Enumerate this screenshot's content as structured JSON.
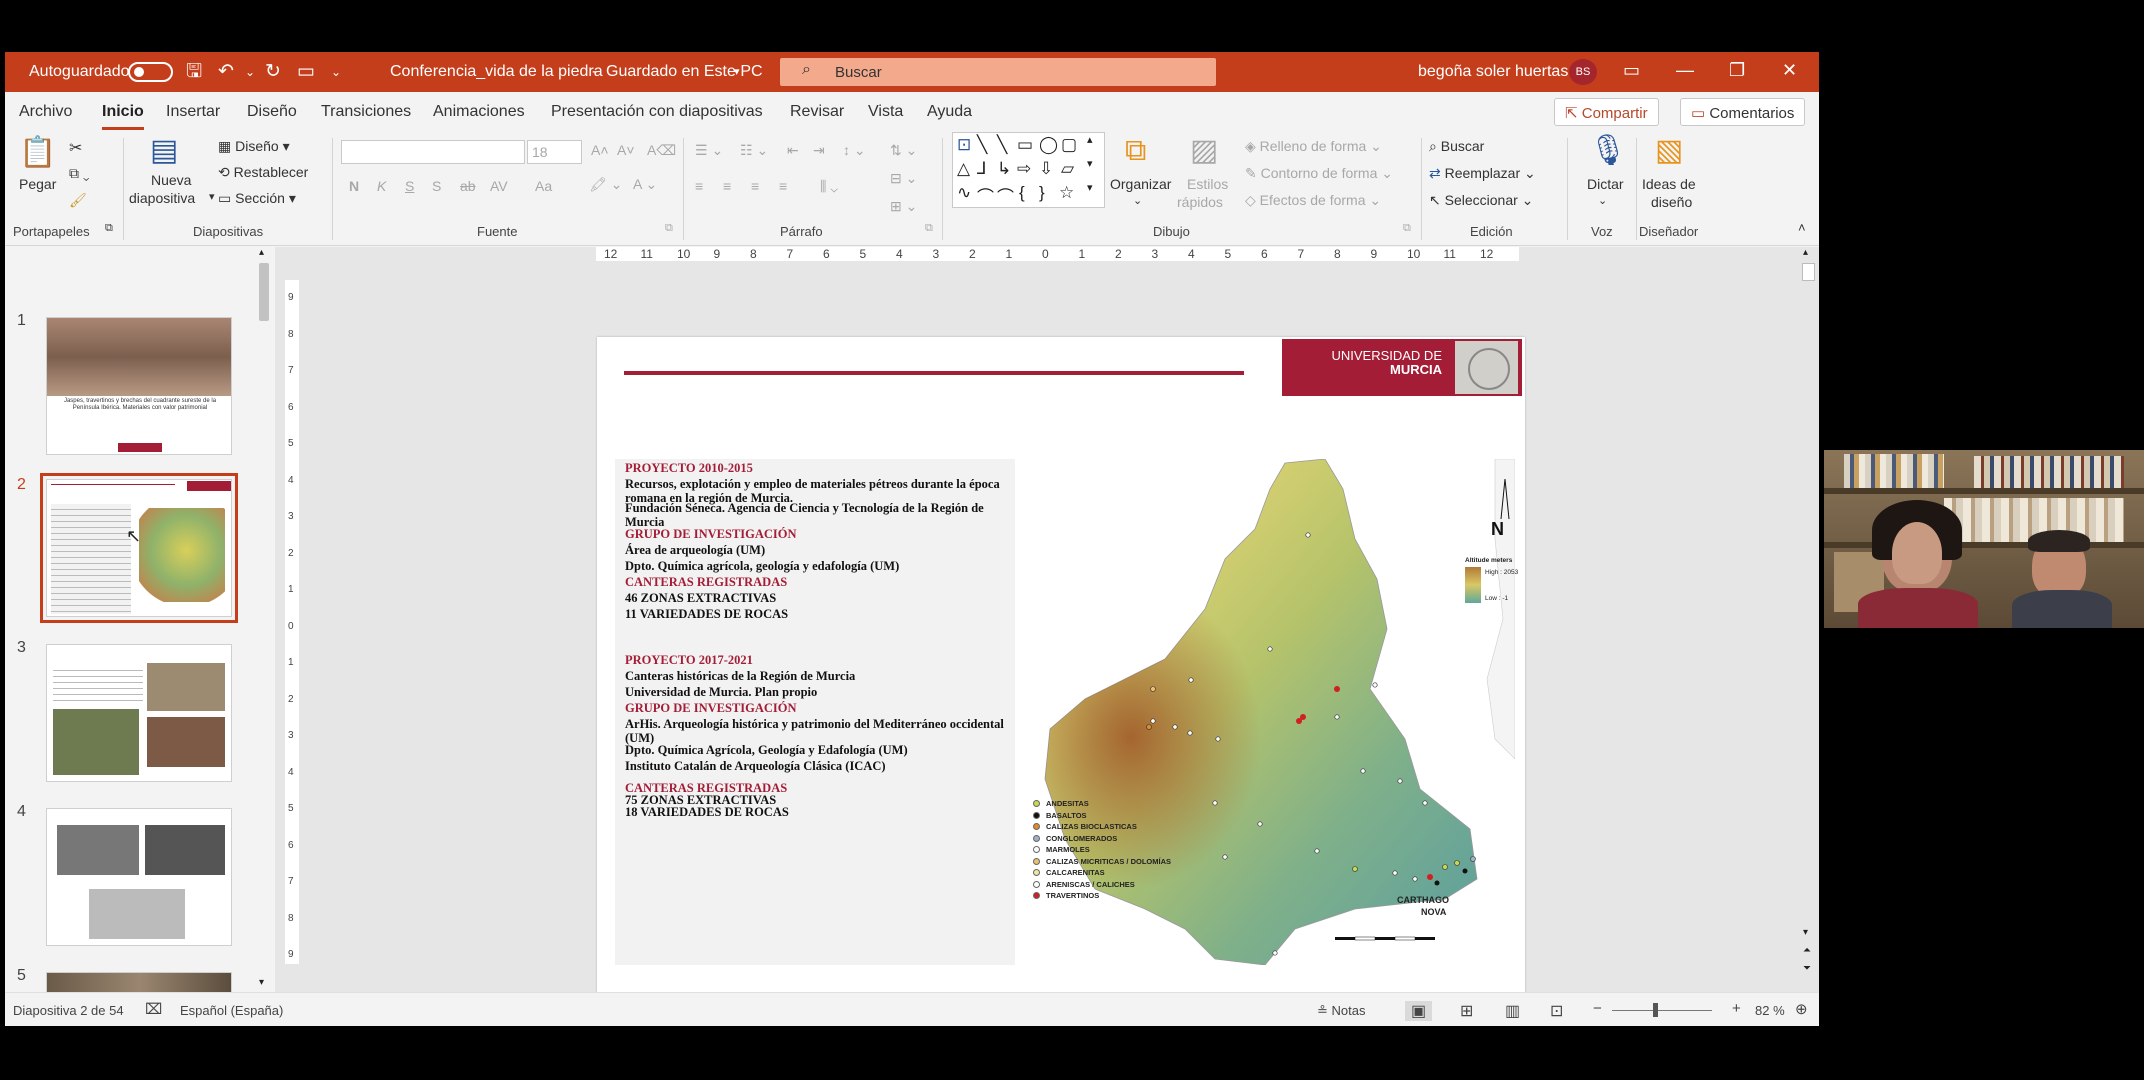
{
  "titlebar": {
    "autosave_label": "Autoguardado",
    "document_title": "Conferencia_vida de la piedra",
    "save_status": "Guardado en Este PC",
    "search_placeholder": "Buscar",
    "user_name": "begoña soler huertas",
    "user_initials": "BS"
  },
  "tabs": [
    "Archivo",
    "Inicio",
    "Insertar",
    "Diseño",
    "Transiciones",
    "Animaciones",
    "Presentación con diapositivas",
    "Revisar",
    "Vista",
    "Ayuda"
  ],
  "active_tab": "Inicio",
  "share_label": "Compartir",
  "comments_label": "Comentarios",
  "ribbon": {
    "clipboard": {
      "paste": "Pegar",
      "group": "Portapapeles"
    },
    "slides": {
      "new_slide_1": "Nueva",
      "new_slide_2": "diapositiva",
      "layout": "Diseño",
      "reset": "Restablecer",
      "section": "Sección",
      "group": "Diapositivas"
    },
    "font": {
      "size": "18",
      "group": "Fuente",
      "bold": "N",
      "italic": "K",
      "underline": "S",
      "shadow": "S",
      "strike": "ab",
      "spacing": "AV",
      "case": "Aa"
    },
    "paragraph": {
      "group": "Párrafo"
    },
    "drawing": {
      "arrange": "Organizar",
      "quick_styles_1": "Estilos",
      "quick_styles_2": "rápidos",
      "fill": "Relleno de forma",
      "outline": "Contorno de forma",
      "effects": "Efectos de forma",
      "group": "Dibujo"
    },
    "editing": {
      "find": "Buscar",
      "replace": "Reemplazar",
      "select": "Seleccionar",
      "group": "Edición"
    },
    "voice": {
      "dictate": "Dictar",
      "group": "Voz"
    },
    "designer": {
      "ideas_1": "Ideas de",
      "ideas_2": "diseño",
      "group": "Diseñador"
    }
  },
  "thumbnails": [
    {
      "number": "1",
      "caption": "Jaspes, travertinos y brechas del cuadrante sureste de la Península Ibérica. Materiales con valor patrimonial"
    },
    {
      "number": "2"
    },
    {
      "number": "3"
    },
    {
      "number": "4"
    },
    {
      "number": "5"
    }
  ],
  "ruler": {
    "h": [
      "12",
      "11",
      "10",
      "9",
      "8",
      "7",
      "6",
      "5",
      "4",
      "3",
      "2",
      "1",
      "0",
      "1",
      "2",
      "3",
      "4",
      "5",
      "6",
      "7",
      "8",
      "9",
      "10",
      "11",
      "12"
    ],
    "v": [
      "9",
      "8",
      "7",
      "6",
      "5",
      "4",
      "3",
      "2",
      "1",
      "0",
      "1",
      "2",
      "3",
      "4",
      "5",
      "6",
      "7",
      "8",
      "9"
    ]
  },
  "slide": {
    "university_line1": "UNIVERSIDAD DE",
    "university_line2": "MURCIA",
    "lines": [
      {
        "text": "PROYECTO 2010-2015",
        "style": "red"
      },
      {
        "text": "Recursos, explotación y empleo de materiales pétreos durante la época romana en la región de Murcia.",
        "style": "black"
      },
      {
        "text": "Fundación Séneca. Agencia de Ciencia y Tecnología de la Región de Murcia",
        "style": "black"
      },
      {
        "text": "GRUPO DE INVESTIGACIÓN",
        "style": "red"
      },
      {
        "text": "Área de arqueología (UM)",
        "style": "black"
      },
      {
        "text": "Dpto. Química agrícola, geología y edafología (UM)",
        "style": "black"
      },
      {
        "text": "CANTERAS REGISTRADAS",
        "style": "red"
      },
      {
        "text": "46 ZONAS EXTRACTIVAS",
        "style": "black"
      },
      {
        "text": "11 VARIEDADES DE ROCAS",
        "style": "black"
      },
      {
        "text": "PROYECTO 2017-2021",
        "style": "red"
      },
      {
        "text": "Canteras históricas de la Región de Murcia",
        "style": "black"
      },
      {
        "text": "Universidad de Murcia. Plan propio",
        "style": "black"
      },
      {
        "text": "GRUPO DE INVESTIGACIÓN",
        "style": "red"
      },
      {
        "text": "ArHis. Arqueología histórica y patrimonio del Mediterráneo occidental (UM)",
        "style": "black"
      },
      {
        "text": "Dpto. Química Agrícola, Geología y Edafología (UM)",
        "style": "black"
      },
      {
        "text": "Instituto Catalán de Arqueología Clásica (ICAC)",
        "style": "black"
      },
      {
        "text": "CANTERAS REGISTRADAS",
        "style": "red"
      },
      {
        "text": "75 ZONAS EXTRACTIVAS",
        "style": "black"
      },
      {
        "text": "18 VARIEDADES DE ROCAS",
        "style": "black"
      }
    ],
    "map": {
      "north_label": "N",
      "altitude_title": "Altitude meters",
      "altitude_high": "High : 2053",
      "altitude_low": "Low : -1",
      "city_label_1": "CARTHAGO",
      "city_label_2": "NOVA",
      "legend": [
        {
          "label": "ANDESITAS",
          "color": "#c8d84a"
        },
        {
          "label": "BASALTOS",
          "color": "#111111"
        },
        {
          "label": "CALIZAS BIOCLASTICAS",
          "color": "#e08a2a"
        },
        {
          "label": "CONGLOMERADOS",
          "color": "#9fb0c8"
        },
        {
          "label": "MARMOLES",
          "color": "#ffffff"
        },
        {
          "label": "CALIZAS MICRITICAS / DOLOMÍAS",
          "color": "#e8c070"
        },
        {
          "label": "CALCARENITAS",
          "color": "#ece7a0"
        },
        {
          "label": "ARENISCAS / CALICHES",
          "color": "#ffffff"
        },
        {
          "label": "TRAVERTINOS",
          "color": "#d02020"
        }
      ]
    }
  },
  "status": {
    "slide_counter": "Diapositiva 2 de 54",
    "language": "Español (España)",
    "notes": "Notas",
    "zoom": "82 %"
  },
  "colors": {
    "accent": "#c43e1c",
    "slide_red": "#a41d36"
  }
}
